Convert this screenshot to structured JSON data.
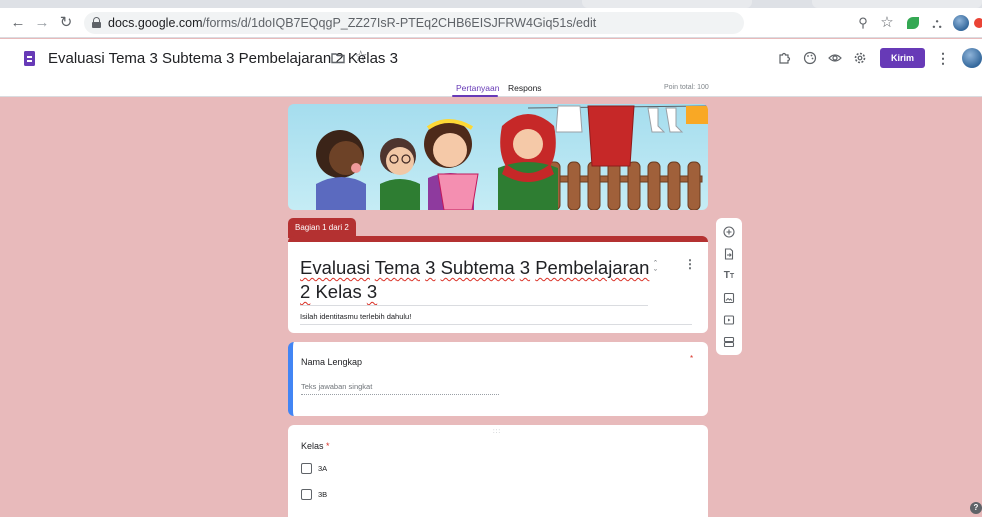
{
  "browser": {
    "url_host": "docs.google.com",
    "url_path": "/forms/d/1doIQB7EQqgP_ZZ27IsR-PTEq2CHB6EISJFRW4Giq51s/edit"
  },
  "header": {
    "title": "Evaluasi Tema 3 Subtema 3 Pembelajaran 2 Kelas 3",
    "send_label": "Kirim",
    "tabs": [
      {
        "label": "Pertanyaan",
        "active": true
      },
      {
        "label": "Respons",
        "active": false
      }
    ],
    "points_total": "Poin total: 100"
  },
  "section": {
    "label": "Bagian 1 dari 2"
  },
  "form": {
    "title_words": [
      "Evaluasi",
      "Tema",
      "3",
      "Subtema",
      "3",
      "Pembelajaran",
      "2",
      "Kelas",
      "3"
    ],
    "description": "Isilah identitasmu terlebih dahulu!"
  },
  "questions": [
    {
      "title": "Nama Lengkap",
      "required": true,
      "type": "short",
      "placeholder": "Teks jawaban singkat"
    },
    {
      "title": "Kelas",
      "required": true,
      "type": "checkbox",
      "options": [
        "3A",
        "3B"
      ]
    }
  ],
  "icons": {
    "extensions": [
      "extension-puzzle-icon",
      "palette-icon",
      "preview-eye-icon",
      "settings-gear-icon"
    ],
    "side_toolbar": [
      "add-question-icon",
      "import-questions-icon",
      "add-title-icon",
      "add-image-icon",
      "add-video-icon",
      "add-section-icon"
    ]
  },
  "colors": {
    "theme": "#b43131",
    "background": "#e8babb",
    "accent": "#673ab7",
    "active_question": "#4285f4"
  }
}
